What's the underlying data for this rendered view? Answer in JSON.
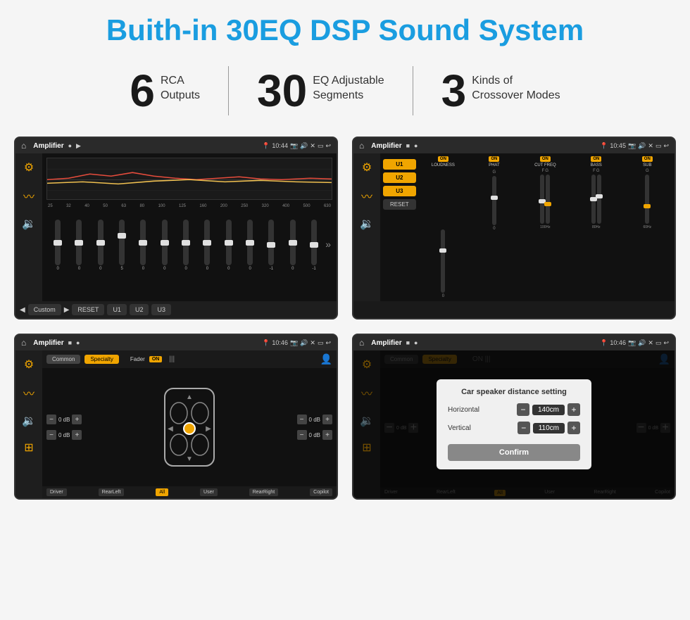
{
  "title": "Buith-in 30EQ DSP Sound System",
  "stats": [
    {
      "number": "6",
      "line1": "RCA",
      "line2": "Outputs"
    },
    {
      "number": "30",
      "line1": "EQ Adjustable",
      "line2": "Segments"
    },
    {
      "number": "3",
      "line1": "Kinds of",
      "line2": "Crossover Modes"
    }
  ],
  "screens": [
    {
      "id": "screen1",
      "status": {
        "time": "10:44",
        "title": "Amplifier"
      },
      "type": "eq",
      "eq_labels": [
        "25",
        "32",
        "40",
        "50",
        "63",
        "80",
        "100",
        "125",
        "160",
        "200",
        "250",
        "320",
        "400",
        "500",
        "630"
      ],
      "eq_values": [
        "0",
        "0",
        "0",
        "5",
        "0",
        "0",
        "0",
        "0",
        "0",
        "0",
        "-1",
        "0",
        "-1"
      ],
      "bottom_buttons": [
        "◀",
        "Custom",
        "▶",
        "RESET",
        "U1",
        "U2",
        "U3"
      ]
    },
    {
      "id": "screen2",
      "status": {
        "time": "10:45",
        "title": "Amplifier"
      },
      "type": "amp_controls",
      "channels": [
        "U1",
        "U2",
        "U3"
      ],
      "controls": [
        "LOUDNESS",
        "PHAT",
        "CUT FREQ",
        "BASS",
        "SUB"
      ]
    },
    {
      "id": "screen3",
      "status": {
        "time": "10:46",
        "title": "Amplifier"
      },
      "type": "fader",
      "tabs": [
        "Common",
        "Specialty"
      ],
      "fader_label": "Fader",
      "fader_on": "ON",
      "positions": [
        "Driver",
        "Copilot",
        "RearLeft",
        "All",
        "User",
        "RearRight"
      ],
      "db_values": [
        "0 dB",
        "0 dB",
        "0 dB",
        "0 dB"
      ]
    },
    {
      "id": "screen4",
      "status": {
        "time": "10:46",
        "title": "Amplifier"
      },
      "type": "dialog",
      "dialog": {
        "title": "Car speaker distance setting",
        "fields": [
          {
            "label": "Horizontal",
            "value": "140cm"
          },
          {
            "label": "Vertical",
            "value": "110cm"
          }
        ],
        "confirm_label": "Confirm"
      },
      "tabs": [
        "Common",
        "Specialty"
      ],
      "positions": [
        "Driver",
        "Copilot",
        "RearLeft",
        "All",
        "User",
        "RearRight"
      ],
      "db_values": [
        "0 dB",
        "0 dB"
      ]
    }
  ]
}
